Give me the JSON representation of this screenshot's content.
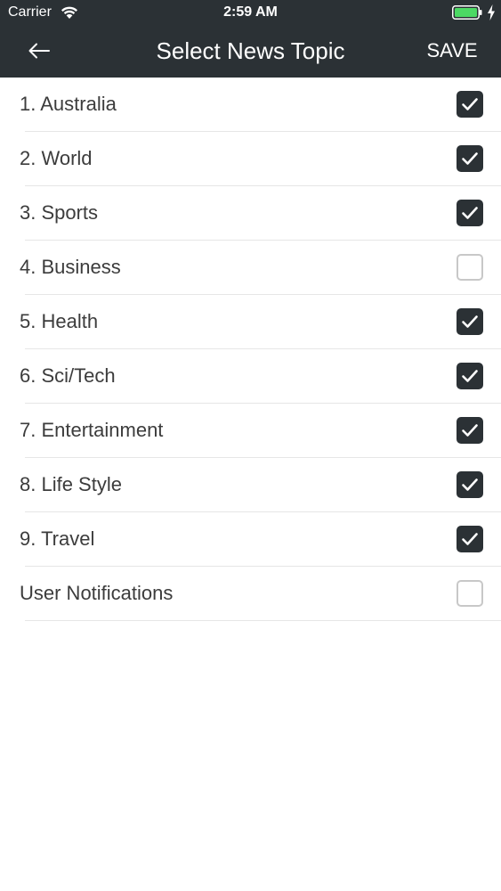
{
  "status_bar": {
    "carrier": "Carrier",
    "time": "2:59 AM"
  },
  "nav": {
    "title": "Select News Topic",
    "save_label": "SAVE",
    "back_icon": "arrow-left-icon"
  },
  "colors": {
    "header_bg": "#2b3135",
    "checkbox_checked": "#2b3135",
    "checkbox_unchecked_border": "#c8c8c8",
    "battery": "#4cd964"
  },
  "topics": [
    {
      "label": "1. Australia",
      "checked": true
    },
    {
      "label": "2. World",
      "checked": true
    },
    {
      "label": "3. Sports",
      "checked": true
    },
    {
      "label": "4. Business",
      "checked": false
    },
    {
      "label": "5. Health",
      "checked": true
    },
    {
      "label": "6. Sci/Tech",
      "checked": true
    },
    {
      "label": "7. Entertainment",
      "checked": true
    },
    {
      "label": "8. Life Style",
      "checked": true
    },
    {
      "label": "9. Travel",
      "checked": true
    },
    {
      "label": "User Notifications",
      "checked": false
    }
  ]
}
